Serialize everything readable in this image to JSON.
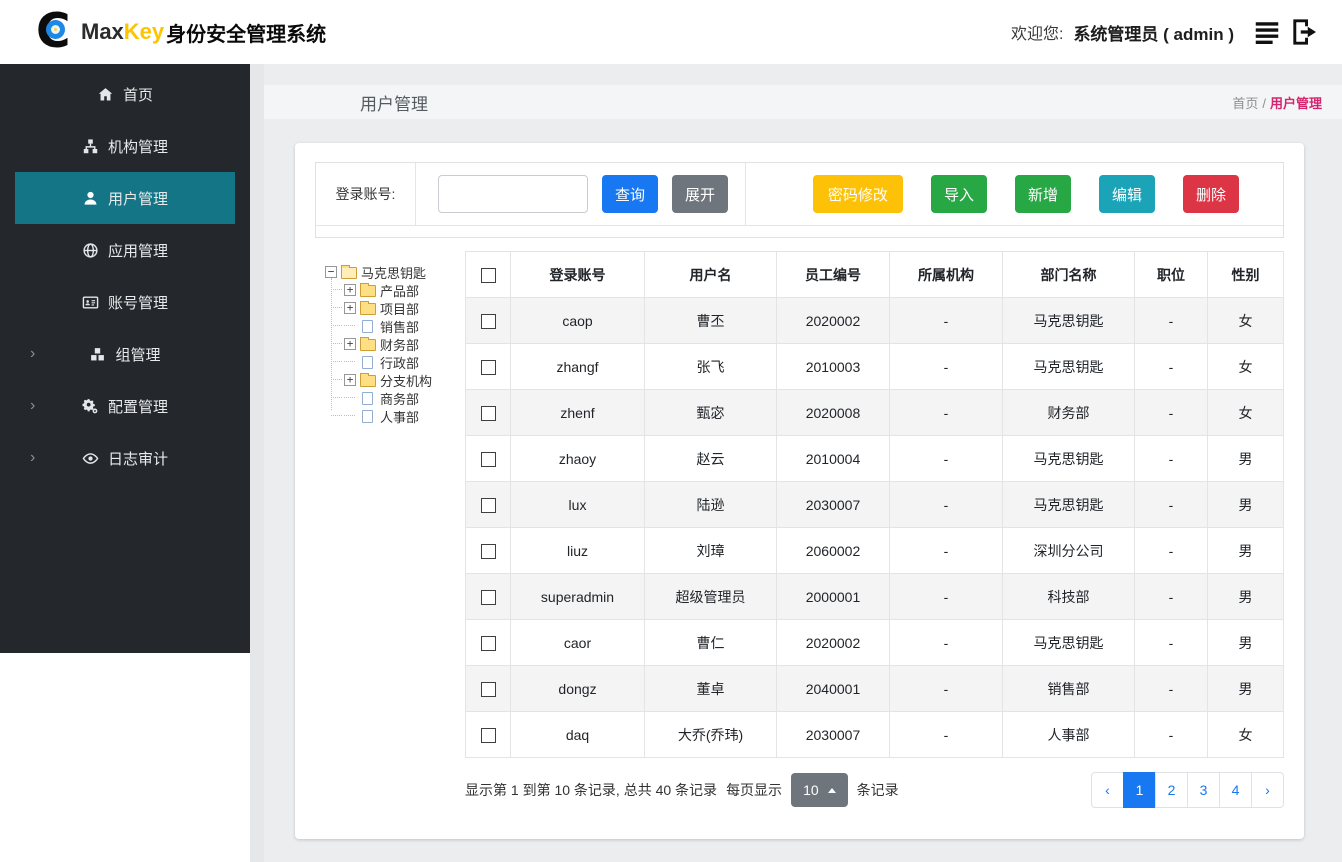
{
  "header": {
    "brand": {
      "max": "Max",
      "key": "Key",
      "suffix": "身份安全管理系统"
    },
    "welcome_label": "欢迎您:",
    "user": "系统管理员 ( admin )",
    "icons": {
      "menu": "list-icon",
      "logout": "sign-out-icon"
    }
  },
  "sidebar": {
    "items": [
      {
        "label": "首页",
        "icon": "home-icon"
      },
      {
        "label": "机构管理",
        "icon": "sitemap-icon"
      },
      {
        "label": "用户管理",
        "icon": "user-icon",
        "active": true
      },
      {
        "label": "应用管理",
        "icon": "globe-icon"
      },
      {
        "label": "账号管理",
        "icon": "id-card-icon"
      },
      {
        "label": "组管理",
        "icon": "cubes-icon",
        "expandable": true
      },
      {
        "label": "配置管理",
        "icon": "gears-icon",
        "expandable": true
      },
      {
        "label": "日志审计",
        "icon": "eye-icon",
        "expandable": true
      }
    ]
  },
  "page": {
    "title": "用户管理",
    "breadcrumb": {
      "home": "首页",
      "separator": "/",
      "current": "用户管理"
    }
  },
  "search": {
    "label": "登录账号:",
    "input_value": "",
    "query_button": "查询",
    "expand_button": "展开"
  },
  "actions": {
    "password": "密码修改",
    "import": "导入",
    "add": "新增",
    "edit": "编辑",
    "delete": "删除"
  },
  "tree": {
    "root": {
      "label": "马克思钥匙",
      "expander": "−"
    },
    "children": [
      {
        "label": "产品部",
        "expander": "+",
        "type": "folder"
      },
      {
        "label": "项目部",
        "expander": "+",
        "type": "folder"
      },
      {
        "label": "销售部",
        "expander": "",
        "type": "leaf"
      },
      {
        "label": "财务部",
        "expander": "+",
        "type": "folder"
      },
      {
        "label": "行政部",
        "expander": "",
        "type": "leaf"
      },
      {
        "label": "分支机构",
        "expander": "+",
        "type": "folder"
      },
      {
        "label": "商务部",
        "expander": "",
        "type": "leaf"
      },
      {
        "label": "人事部",
        "expander": "",
        "type": "leaf"
      }
    ]
  },
  "table": {
    "headers": [
      "登录账号",
      "用户名",
      "员工编号",
      "所属机构",
      "部门名称",
      "职位",
      "性别"
    ],
    "rows": [
      {
        "login": "caop",
        "name": "曹丕",
        "emp": "2020002",
        "org": "-",
        "dept": "马克思钥匙",
        "pos": "-",
        "gender": "女"
      },
      {
        "login": "zhangf",
        "name": "张飞",
        "emp": "2010003",
        "org": "-",
        "dept": "马克思钥匙",
        "pos": "-",
        "gender": "女"
      },
      {
        "login": "zhenf",
        "name": "甄宓",
        "emp": "2020008",
        "org": "-",
        "dept": "财务部",
        "pos": "-",
        "gender": "女"
      },
      {
        "login": "zhaoy",
        "name": "赵云",
        "emp": "2010004",
        "org": "-",
        "dept": "马克思钥匙",
        "pos": "-",
        "gender": "男"
      },
      {
        "login": "lux",
        "name": "陆逊",
        "emp": "2030007",
        "org": "-",
        "dept": "马克思钥匙",
        "pos": "-",
        "gender": "男"
      },
      {
        "login": "liuz",
        "name": "刘璋",
        "emp": "2060002",
        "org": "-",
        "dept": "深圳分公司",
        "pos": "-",
        "gender": "男"
      },
      {
        "login": "superadmin",
        "name": "超级管理员",
        "emp": "2000001",
        "org": "-",
        "dept": "科技部",
        "pos": "-",
        "gender": "男"
      },
      {
        "login": "caor",
        "name": "曹仁",
        "emp": "2020002",
        "org": "-",
        "dept": "马克思钥匙",
        "pos": "-",
        "gender": "男"
      },
      {
        "login": "dongz",
        "name": "董卓",
        "emp": "2040001",
        "org": "-",
        "dept": "销售部",
        "pos": "-",
        "gender": "男"
      },
      {
        "login": "daq",
        "name": "大乔(乔玮)",
        "emp": "2030007",
        "org": "-",
        "dept": "人事部",
        "pos": "-",
        "gender": "女"
      }
    ]
  },
  "footer": {
    "summary_prefix": "显示第 1 到第 10 条记录, 总共 40 条记录",
    "per_page_label": "每页显示",
    "page_size": "10",
    "summary_suffix": "条记录",
    "pagination": {
      "prev": "‹",
      "pages": [
        "1",
        "2",
        "3",
        "4"
      ],
      "active_page": "1",
      "next": "›"
    }
  },
  "colors": {
    "sidebar_dark": "#24272b",
    "active_teal": "#147587",
    "primary_blue": "#1778f2",
    "secondary_gray": "#6e757d",
    "warning_yellow": "#fdc107",
    "success_green": "#28a745",
    "info_teal": "#1ba3b8",
    "danger_red": "#dc3545",
    "breadcrumb_pink": "#d6246f",
    "brand_yellow": "#fdc400"
  }
}
